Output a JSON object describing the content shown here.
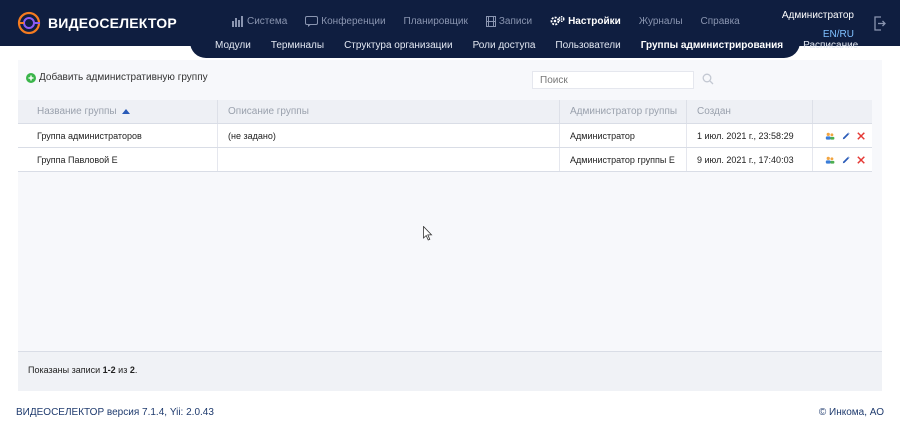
{
  "app": {
    "logo_text": "ВИДЕОСЕЛЕКТОР"
  },
  "main_nav": [
    {
      "label": "Система",
      "icon": "bar-chart-icon",
      "active": false
    },
    {
      "label": "Конференции",
      "icon": "chat-icon",
      "active": false
    },
    {
      "label": "Планировщик",
      "icon": "",
      "active": false
    },
    {
      "label": "Записи",
      "icon": "film-icon",
      "active": false
    },
    {
      "label": "Настройки",
      "icon": "gears-icon",
      "active": true
    },
    {
      "label": "Журналы",
      "icon": "",
      "active": false
    },
    {
      "label": "Справка",
      "icon": "",
      "active": false
    }
  ],
  "sub_nav": [
    {
      "label": "Модули",
      "active": false
    },
    {
      "label": "Терминалы",
      "active": false
    },
    {
      "label": "Структура организации",
      "active": false
    },
    {
      "label": "Роли доступа",
      "active": false
    },
    {
      "label": "Пользователи",
      "active": false
    },
    {
      "label": "Группы администрирования",
      "active": true
    },
    {
      "label": "Расписание",
      "active": false
    }
  ],
  "user": {
    "name": "Администратор",
    "lang": "EN/RU"
  },
  "toolbar": {
    "add_label": "Добавить административную группу",
    "search_placeholder": "Поиск",
    "search_value": ""
  },
  "table": {
    "columns": [
      "Название группы",
      "Описание группы",
      "Администратор группы",
      "Создан",
      ""
    ],
    "sort_column": 0,
    "rows": [
      {
        "name": "Группа администраторов",
        "description": "(не задано)",
        "admin": "Администратор",
        "created": "1 июл. 2021 г., 23:58:29"
      },
      {
        "name": "Группа Павловой Е",
        "description": "",
        "admin": "Администратор группы Е",
        "created": "9 июл. 2021 г., 17:40:03"
      }
    ]
  },
  "summary": {
    "prefix": "Показаны записи ",
    "range": "1-2",
    "middle": " из ",
    "total": "2",
    "suffix": "."
  },
  "footer": {
    "version": "ВИДЕОСЕЛЕКТОР версия 7.1.4, Yii: 2.0.43",
    "copyright": "© Инкома, АО"
  },
  "colors": {
    "header_bg": "#0f1e40",
    "accent_orange": "#f47b20",
    "accent_purple": "#8b5cf6",
    "add_green": "#3bb54a",
    "delete_red": "#e53935"
  }
}
